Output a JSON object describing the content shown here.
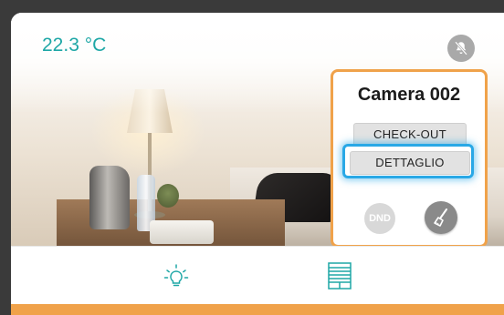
{
  "status": {
    "temperature": "22.3 °C"
  },
  "room": {
    "name": "Camera 002",
    "checkout_label": "CHECK-OUT",
    "detail_label": "DETTAGLIO",
    "dnd_label": "DND"
  },
  "icons": {
    "mute": "bell-off-icon",
    "cleaning": "broom-icon",
    "light": "lightbulb-icon",
    "blinds": "window-blinds-icon"
  },
  "colors": {
    "accent": "#f0a24a",
    "focus": "#29a8e6",
    "temperature": "#1ea7a6"
  }
}
